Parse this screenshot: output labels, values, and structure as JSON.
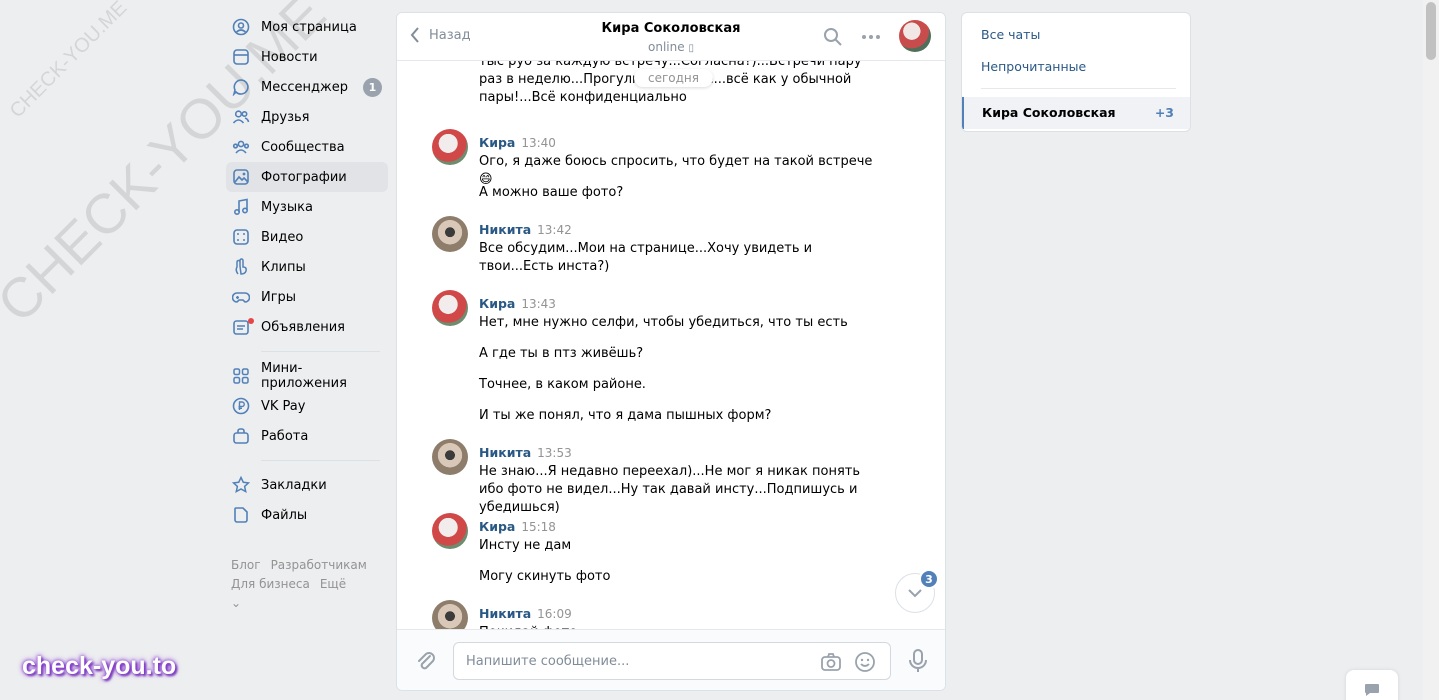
{
  "watermark": {
    "small": "CHECK-YOU.ME",
    "large": "CHECK-YOU.ME",
    "brand": "check-you.to"
  },
  "nav": {
    "items": [
      {
        "label": "Моя страница",
        "icon": "profile-icon"
      },
      {
        "label": "Новости",
        "icon": "news-icon"
      },
      {
        "label": "Мессенджер",
        "icon": "messenger-icon",
        "badge": "1"
      },
      {
        "label": "Друзья",
        "icon": "friends-icon"
      },
      {
        "label": "Сообщества",
        "icon": "communities-icon"
      },
      {
        "label": "Фотографии",
        "icon": "photos-icon",
        "active": true
      },
      {
        "label": "Музыка",
        "icon": "music-icon"
      },
      {
        "label": "Видео",
        "icon": "video-icon"
      },
      {
        "label": "Клипы",
        "icon": "clips-icon"
      },
      {
        "label": "Игры",
        "icon": "games-icon"
      },
      {
        "label": "Объявления",
        "icon": "classifieds-icon"
      }
    ],
    "items2": [
      {
        "label": "Мини-приложения",
        "icon": "apps-icon"
      },
      {
        "label": "VK Pay",
        "icon": "vkpay-icon"
      },
      {
        "label": "Работа",
        "icon": "work-icon"
      }
    ],
    "items3": [
      {
        "label": "Закладки",
        "icon": "bookmarks-icon"
      },
      {
        "label": "Файлы",
        "icon": "files-icon"
      }
    ],
    "footer": {
      "blog": "Блог",
      "dev": "Разработчикам",
      "business": "Для бизнеса",
      "more": "Ещё"
    }
  },
  "chat": {
    "back": "Назад",
    "peer": "Кира Соколовская",
    "status": "online",
    "date_pill": "сегодня",
    "first_text": "тыс руб за каждую встречу...Согласна?)...Встречи пару раз в неделю...Прогулки,общение...всё как у обычной пары!...Всё конфиденциально",
    "messages": [
      {
        "author": "Кира",
        "time": "13:40",
        "who": "kira",
        "lines": [
          "Ого, я даже боюсь спросить, что будет на такой встрече 😄",
          "А можно ваше фото?"
        ]
      },
      {
        "author": "Никита",
        "time": "13:42",
        "who": "nik",
        "lines": [
          "Все обсудим...Мои на странице...Хочу увидеть и твои...Есть инста?)"
        ]
      },
      {
        "author": "Кира",
        "time": "13:43",
        "who": "kira",
        "lines": [
          "Нет, мне нужно селфи, чтобы убедиться, что ты есть",
          "А где ты в птз живёшь?",
          "Точнее, в каком районе.",
          "И ты же понял, что я дама пышных форм?"
        ]
      },
      {
        "author": "Никита",
        "time": "13:53",
        "who": "nik",
        "lines": [
          "Не знаю...Я недавно переехал)...Не мог я никак понять ибо фото не видел...Ну так давай инсту...Подпишусь и убедишься)"
        ]
      },
      {
        "author": "Кира",
        "time": "15:18",
        "who": "kira",
        "lines": [
          "Инсту не дам",
          "Могу скинуть фото"
        ]
      },
      {
        "author": "Никита",
        "time": "16:09",
        "who": "nik",
        "lines": [
          "Покидай фото"
        ]
      }
    ],
    "unread_badge": "3",
    "input_placeholder": "Напишите сообщение..."
  },
  "right_panel": {
    "all_chats": "Все чаты",
    "unread": "Непрочитанные",
    "conversation": {
      "name": "Кира Соколовская",
      "count": "+3"
    }
  },
  "colors": {
    "accent": "#5181b8",
    "link": "#2a5885",
    "muted": "#818c99"
  }
}
